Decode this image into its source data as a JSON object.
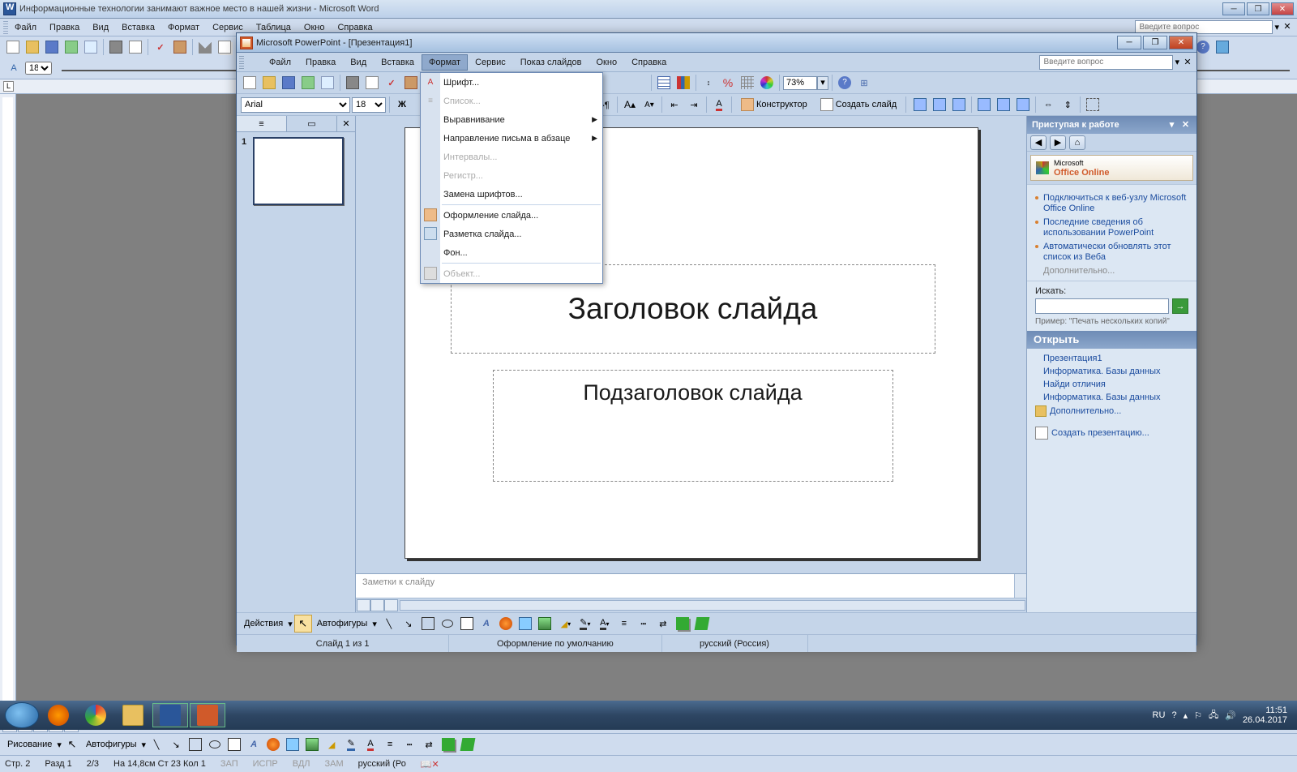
{
  "word": {
    "title": "Информационные технологии занимают важное место в нашей жизни - Microsoft Word",
    "menus": [
      "Файл",
      "Правка",
      "Вид",
      "Вставка",
      "Формат",
      "Сервис",
      "Таблица",
      "Окно",
      "Справка"
    ],
    "help_placeholder": "Введите вопрос",
    "font_size": "18",
    "zoom": "",
    "drawing": {
      "label": "Рисование",
      "autoshapes": "Автофигуры"
    },
    "status": {
      "page": "Стр. 2",
      "section": "Разд 1",
      "pages": "2/3",
      "pos": "На 14,8см  Ст 23  Кол 1",
      "zap": "ЗАП",
      "ispr": "ИСПР",
      "vdl": "ВДЛ",
      "zam": "ЗАМ",
      "lang": "русский (Ро"
    }
  },
  "ppt": {
    "title": "Microsoft PowerPoint - [Презентация1]",
    "menus": [
      "Файл",
      "Правка",
      "Вид",
      "Вставка",
      "Формат",
      "Сервис",
      "Показ слайдов",
      "Окно",
      "Справка"
    ],
    "active_menu": "Формат",
    "help_placeholder": "Введите вопрос",
    "font_name": "Arial",
    "font_size": "18",
    "zoom": "73%",
    "toolbar": {
      "designer": "Конструктор",
      "new_slide": "Создать слайд"
    },
    "format_menu": {
      "font": "Шрифт...",
      "list": "Список...",
      "align": "Выравнивание",
      "direction": "Направление письма в абзаце",
      "intervals": "Интервалы...",
      "case": "Регистр...",
      "replace_fonts": "Замена шрифтов...",
      "slide_design": "Оформление слайда...",
      "slide_layout": "Разметка слайда...",
      "background": "Фон...",
      "object": "Объект..."
    },
    "slide": {
      "number": "1",
      "title": "Заголовок слайда",
      "subtitle": "Подзаголовок слайда"
    },
    "notes_placeholder": "Заметки к слайду",
    "drawing": {
      "actions": "Действия",
      "autoshapes": "Автофигуры"
    },
    "status": {
      "slide": "Слайд 1 из 1",
      "design": "Оформление по умолчанию",
      "lang": "русский (Россия)"
    },
    "taskpane": {
      "title": "Приступая к работе",
      "office_online": "Office Online",
      "office_prefix": "Microsoft",
      "links": [
        "Подключиться к веб-узлу Microsoft Office Online",
        "Последние сведения об использовании PowerPoint",
        "Автоматически обновлять этот список из Веба"
      ],
      "more": "Дополнительно...",
      "search_label": "Искать:",
      "example": "Пример:  \"Печать нескольких копий\"",
      "open_header": "Открыть",
      "open_items": [
        "Презентация1",
        "Информатика. Базы данных",
        "Найди отличия",
        "Информатика. Базы данных"
      ],
      "open_more": "Дополнительно...",
      "create": "Создать презентацию..."
    }
  },
  "tray": {
    "lang": "RU",
    "time": "11:51",
    "date": "26.04.2017"
  }
}
